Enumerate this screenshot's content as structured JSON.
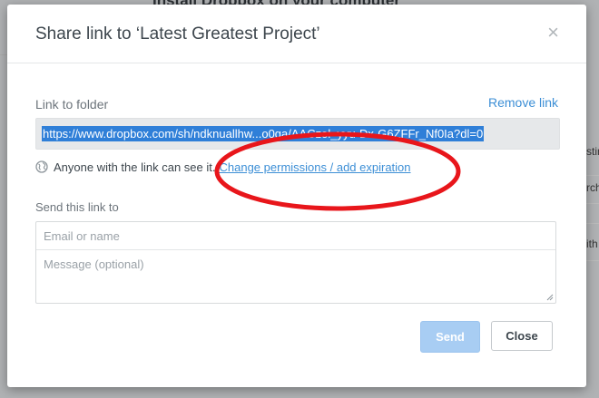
{
  "background": {
    "page_title": "Install Dropbox on your computer",
    "right_fragments": [
      "stin",
      "rch",
      "ith"
    ]
  },
  "dialog": {
    "title": "Share link to ‘Latest Greatest Project’",
    "close_symbol": "×",
    "link_label": "Link to folder",
    "remove_link": "Remove link",
    "link_url": "https://www.dropbox.com/sh/ndknuallhw...o0ga/AACzol_yyu-Dx-G6ZFFr_Nf0Ia?dl=0",
    "permission_text": "Anyone with the link can see it.",
    "permission_link": "Change permissions / add expiration",
    "send_label": "Send this link to",
    "email_placeholder": "Email or name",
    "message_placeholder": "Message (optional)",
    "send_button": "Send",
    "close_button": "Close"
  },
  "colors": {
    "accent": "#3d8fd6",
    "selection": "#2f7fd8",
    "annotation": "#e8161b",
    "send_disabled": "#a8cdf3"
  },
  "icons": {
    "permission": "globe-icon",
    "dismiss": "close-icon"
  }
}
